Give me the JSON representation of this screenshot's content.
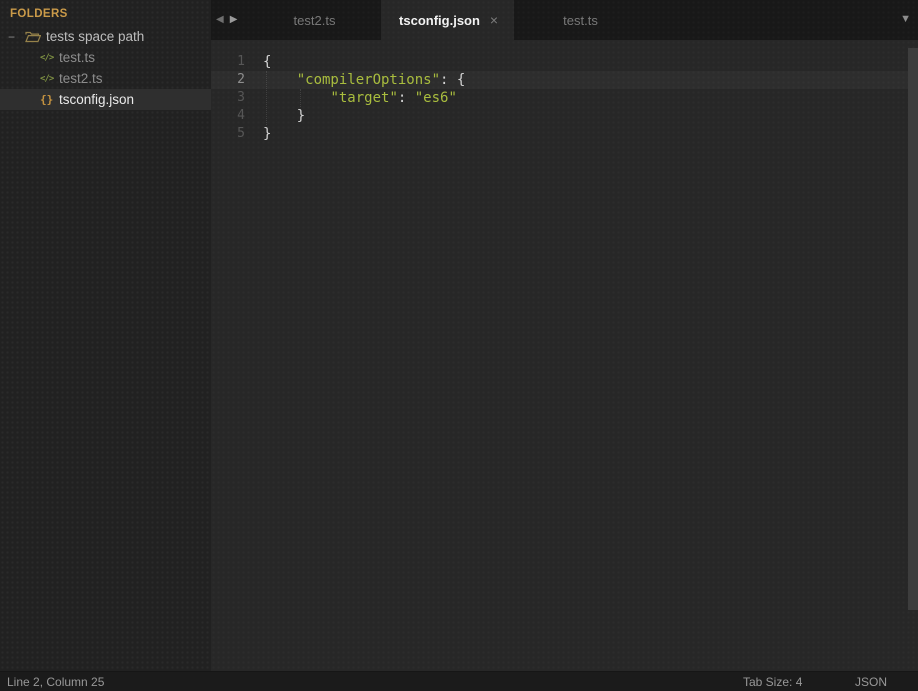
{
  "sidebar": {
    "header": "FOLDERS",
    "folder": {
      "name": "tests space path",
      "collapse_glyph": "−"
    },
    "files": [
      {
        "name": "test.ts",
        "icon": "ts-file-icon",
        "glyph": "</>"
      },
      {
        "name": "test2.ts",
        "icon": "ts-file-icon",
        "glyph": "</>"
      },
      {
        "name": "tsconfig.json",
        "icon": "json-file-icon",
        "glyph": "{}",
        "selected": true
      }
    ]
  },
  "tabbar": {
    "back_glyph": "◀",
    "forward_glyph": "▶",
    "overflow_glyph": "▼",
    "tabs": [
      {
        "label": "test2.ts",
        "active": false
      },
      {
        "label": "tsconfig.json",
        "active": true,
        "close_glyph": "×"
      },
      {
        "label": "test.ts",
        "active": false
      }
    ]
  },
  "editor": {
    "lines": [
      {
        "num": "1",
        "tokens": [
          {
            "text": "{",
            "type": "punct"
          }
        ]
      },
      {
        "num": "2",
        "current": true,
        "tokens": [
          {
            "text": "    ",
            "type": "punct"
          },
          {
            "text": "\"compilerOptions\"",
            "type": "string"
          },
          {
            "text": ": {",
            "type": "punct"
          }
        ]
      },
      {
        "num": "3",
        "tokens": [
          {
            "text": "        ",
            "type": "punct"
          },
          {
            "text": "\"target\"",
            "type": "string"
          },
          {
            "text": ": ",
            "type": "punct"
          },
          {
            "text": "\"es6\"",
            "type": "string"
          }
        ]
      },
      {
        "num": "4",
        "tokens": [
          {
            "text": "    }",
            "type": "punct"
          }
        ]
      },
      {
        "num": "5",
        "tokens": [
          {
            "text": "}",
            "type": "punct"
          }
        ]
      }
    ]
  },
  "statusbar": {
    "cursor_position": "Line 2, Column 25",
    "tab_size": "Tab Size: 4",
    "syntax": "JSON"
  },
  "colors": {
    "folders_header": "#ca9a49",
    "string_token": "#a9bd3e",
    "json_icon": "#c79440",
    "ts_icon": "#7f9243",
    "editor_bg": "#272727",
    "sidebar_bg": "#212121",
    "tabbar_bg": "#181818",
    "selected_row_bg": "#2f2f2f",
    "active_tab_text": "#f2f2f2"
  }
}
